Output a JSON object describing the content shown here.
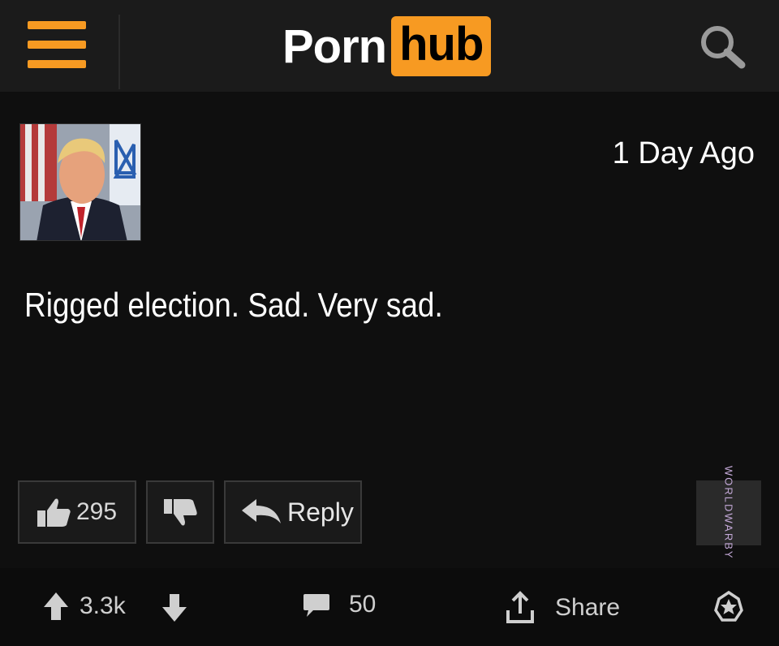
{
  "header": {
    "logo_part1": "Porn",
    "logo_part2": "hub",
    "accent": "#f79a22"
  },
  "post": {
    "timestamp": "1 Day Ago",
    "text": "Rigged election. Sad. Very sad.",
    "likes": "295",
    "reply_label": "Reply"
  },
  "watermark": {
    "text": "WORLDWARBY"
  },
  "footer": {
    "votes": "3.3k",
    "comments": "50",
    "share_label": "Share"
  },
  "icons": [
    "menu-icon",
    "search-icon",
    "thumbs-up-icon",
    "thumbs-down-icon",
    "reply-arrow-icon",
    "upvote-icon",
    "downvote-icon",
    "comment-icon",
    "share-icon",
    "award-icon"
  ]
}
